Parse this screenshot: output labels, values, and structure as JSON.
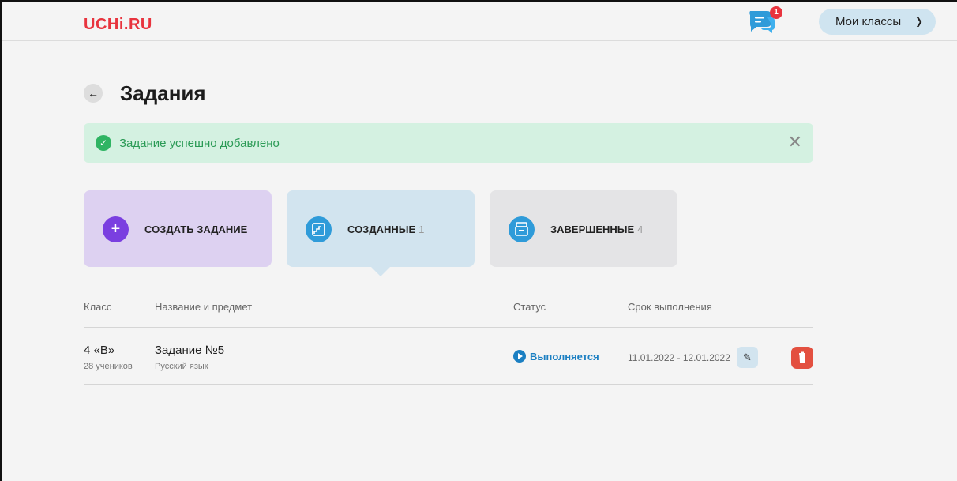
{
  "header": {
    "logo_text": "UCHi.RU",
    "chat_badge": "1",
    "classes_label": "Мои классы"
  },
  "page": {
    "title": "Задания"
  },
  "alert": {
    "message": "Задание успешно добавлено"
  },
  "cards": {
    "create_label": "СОЗДАТЬ ЗАДАНИЕ",
    "created_label": "СОЗДАННЫЕ",
    "created_count": "1",
    "done_label": "ЗАВЕРШЕННЫЕ",
    "done_count": "4"
  },
  "table": {
    "headers": [
      "Класс",
      "Название и предмет",
      "Статус",
      "Срок выполнения"
    ],
    "rows": [
      {
        "class": "4 «В»",
        "students": "28 учеников",
        "title": "Задание №5",
        "subject": "Русский язык",
        "status": "Выполняется",
        "deadline": "11.01.2022 - 12.01.2022"
      }
    ]
  },
  "colors": {
    "brand_red": "#e8343e",
    "success_green": "#2fb463",
    "create_purple": "#7a3fe0",
    "status_blue": "#1b7fc2",
    "delete_red": "#e35040"
  },
  "icons": {
    "chat": "chat-bubbles-icon",
    "back": "arrow-left-icon",
    "success": "check-circle-icon",
    "close": "close-icon",
    "create": "plus-icon",
    "created": "stairs-icon",
    "done": "archive-icon",
    "status": "play-circle-icon",
    "edit": "pencil-icon",
    "delete": "trash-icon"
  }
}
